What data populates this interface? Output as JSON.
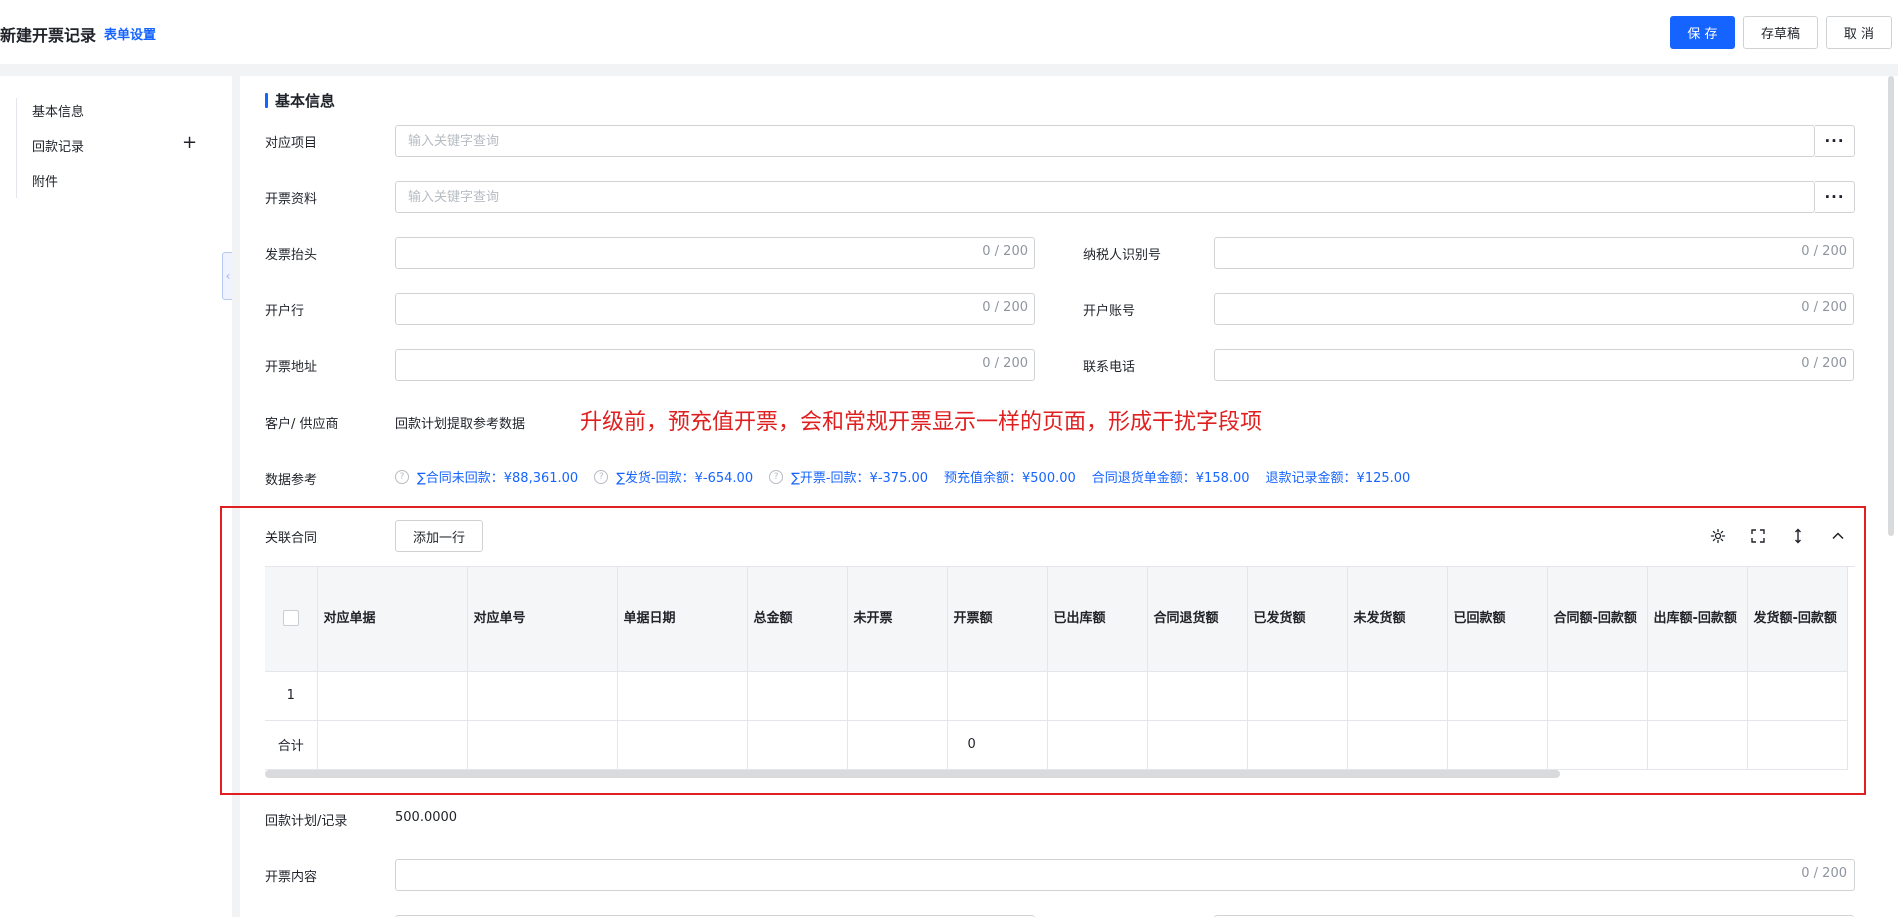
{
  "header": {
    "title": "新建开票记录",
    "form_settings": "表单设置",
    "save": "保 存",
    "draft": "存草稿",
    "cancel": "取 消"
  },
  "nav": {
    "items": [
      "基本信息",
      "回款记录",
      "附件"
    ],
    "plus": "+",
    "collapse": "‹"
  },
  "section_title": "基本信息",
  "fields": {
    "project": {
      "label": "对应项目",
      "placeholder": "输入关键字查询",
      "more": "···"
    },
    "invoice_info": {
      "label": "开票资料",
      "placeholder": "输入关键字查询",
      "more": "···"
    },
    "invoice_title": {
      "label": "发票抬头",
      "count": "0 / 200"
    },
    "taxpayer_id": {
      "label": "纳税人识别号",
      "count": "0 / 200"
    },
    "bank": {
      "label": "开户行",
      "count": "0 / 200"
    },
    "account": {
      "label": "开户账号",
      "count": "0 / 200"
    },
    "address": {
      "label": "开票地址",
      "count": "0 / 200"
    },
    "phone": {
      "label": "联系电话",
      "count": "0 / 200"
    },
    "customer": {
      "label": "客户/ 供应商",
      "value": "回款计划提取参考数据"
    },
    "reference": {
      "label": "数据参考"
    },
    "contract": {
      "label": "关联合同",
      "add_row": "添加一行"
    },
    "plan": {
      "label": "回款计划/记录",
      "value": "500.0000"
    },
    "content": {
      "label": "开票内容",
      "count": "0 / 200"
    }
  },
  "annotation": "升级前，预充值开票，会和常规开票显示一样的页面，形成干扰字段项",
  "reference_items": [
    {
      "text": "∑合同未回款：¥88,361.00",
      "help": "?"
    },
    {
      "text": "∑发货-回款：¥-654.00",
      "help": "?"
    },
    {
      "text": "∑开票-回款：¥-375.00",
      "help": "?"
    },
    {
      "text": "预充值余额：¥500.00"
    },
    {
      "text": "合同退货单金额：¥158.00"
    },
    {
      "text": "退款记录金额：¥125.00"
    }
  ],
  "table": {
    "columns": [
      "对应单据",
      "对应单号",
      "单据日期",
      "总金额",
      "未开票",
      "开票额",
      "已出库额",
      "合同退货额",
      "已发货额",
      "未发货额",
      "已回款额",
      "合同额-回款额",
      "出库额-回款额",
      "发货额-回款额"
    ],
    "row_index": "1",
    "total_label": "合计",
    "total_invoice": "0"
  },
  "colors": {
    "primary": "#1664ff",
    "annotation": "#e02020"
  }
}
